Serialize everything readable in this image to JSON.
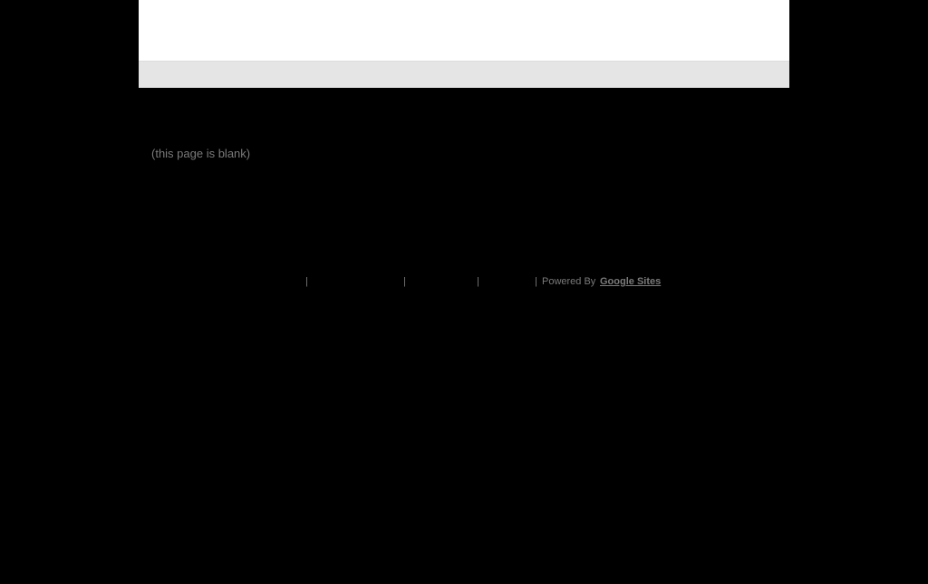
{
  "content": {
    "blank_message": "(this page is blank)"
  },
  "footer": {
    "separator": "|",
    "powered_by": "Powered By",
    "google_sites": "Google Sites"
  },
  "colors": {
    "background": "#000000",
    "header": "#ffffff",
    "nav_bar": "#e5e5e5",
    "muted_text": "#7a7a7a"
  }
}
